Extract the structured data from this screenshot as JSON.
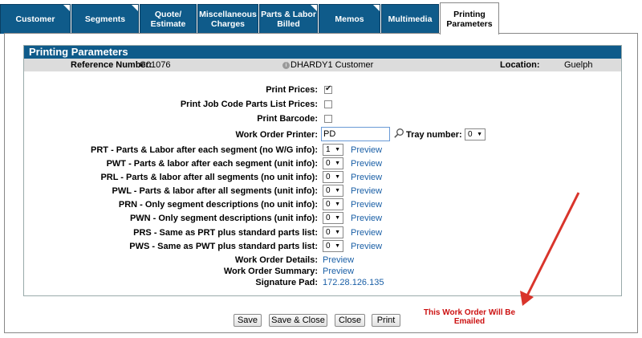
{
  "tabs": [
    {
      "label": "Customer",
      "left": 0
    },
    {
      "label": "Segments",
      "left": 0
    },
    {
      "label": "Quote/\nEstimate",
      "left": 0
    },
    {
      "label": "Miscellaneous\nCharges",
      "left": 0
    },
    {
      "label": "Parts & Labor\nBilled",
      "left": 0
    },
    {
      "label": "Memos",
      "left": 0
    },
    {
      "label": "Multimedia",
      "left": 0
    },
    {
      "label": "Printing\nParameters",
      "left": 0
    }
  ],
  "panel": {
    "title": "Printing Parameters",
    "reference_label": "Reference Number:",
    "reference_value": "C01076",
    "customer": "DHARDY1 Customer",
    "location_label": "Location:",
    "location_value": "Guelph",
    "info_icon_char": "i"
  },
  "options": {
    "print_prices_label": "Print Prices:",
    "print_prices_checked": true,
    "job_code_label": "Print Job Code Parts List Prices:",
    "job_code_checked": false,
    "barcode_label": "Print Barcode:",
    "barcode_checked": false,
    "printer_label": "Work Order Printer:",
    "printer_value": "PD",
    "tray_label": "Tray number:",
    "tray_value": "0"
  },
  "reports": [
    {
      "label": "PRT - Parts & Labor after each segment (no W/G info):",
      "value": "1",
      "link": "Preview"
    },
    {
      "label": "PWT - Parts & labor after each segment (unit info):",
      "value": "0",
      "link": "Preview"
    },
    {
      "label": "PRL - Parts & labor after all segments (no unit info):",
      "value": "0",
      "link": "Preview"
    },
    {
      "label": "PWL - Parts & labor after all segments (unit info):",
      "value": "0",
      "link": "Preview"
    },
    {
      "label": "PRN - Only segment descriptions (no unit info):",
      "value": "0",
      "link": "Preview"
    },
    {
      "label": "PWN - Only segment descriptions (unit info):",
      "value": "0",
      "link": "Preview"
    },
    {
      "label": "PRS - Same as PRT plus standard parts list:",
      "value": "0",
      "link": "Preview"
    },
    {
      "label": "PWS - Same as PWT plus standard parts list:",
      "value": "0",
      "link": "Preview"
    }
  ],
  "extras": {
    "details_label": "Work Order Details:",
    "details_link": "Preview",
    "summary_label": "Work Order Summary:",
    "summary_link": "Preview",
    "signature_label": "Signature Pad:",
    "signature_link": "172.28.126.135"
  },
  "buttons": {
    "save": "Save",
    "save_close": "Save & Close",
    "close": "Close",
    "print": "Print"
  },
  "email_note": "This Work Order Will Be Emailed",
  "colors": {
    "tab_blue": "#0f5b8a",
    "link_blue": "#1a5fa6",
    "alert_red": "#cc1111",
    "arrow_red": "#d9342b"
  }
}
